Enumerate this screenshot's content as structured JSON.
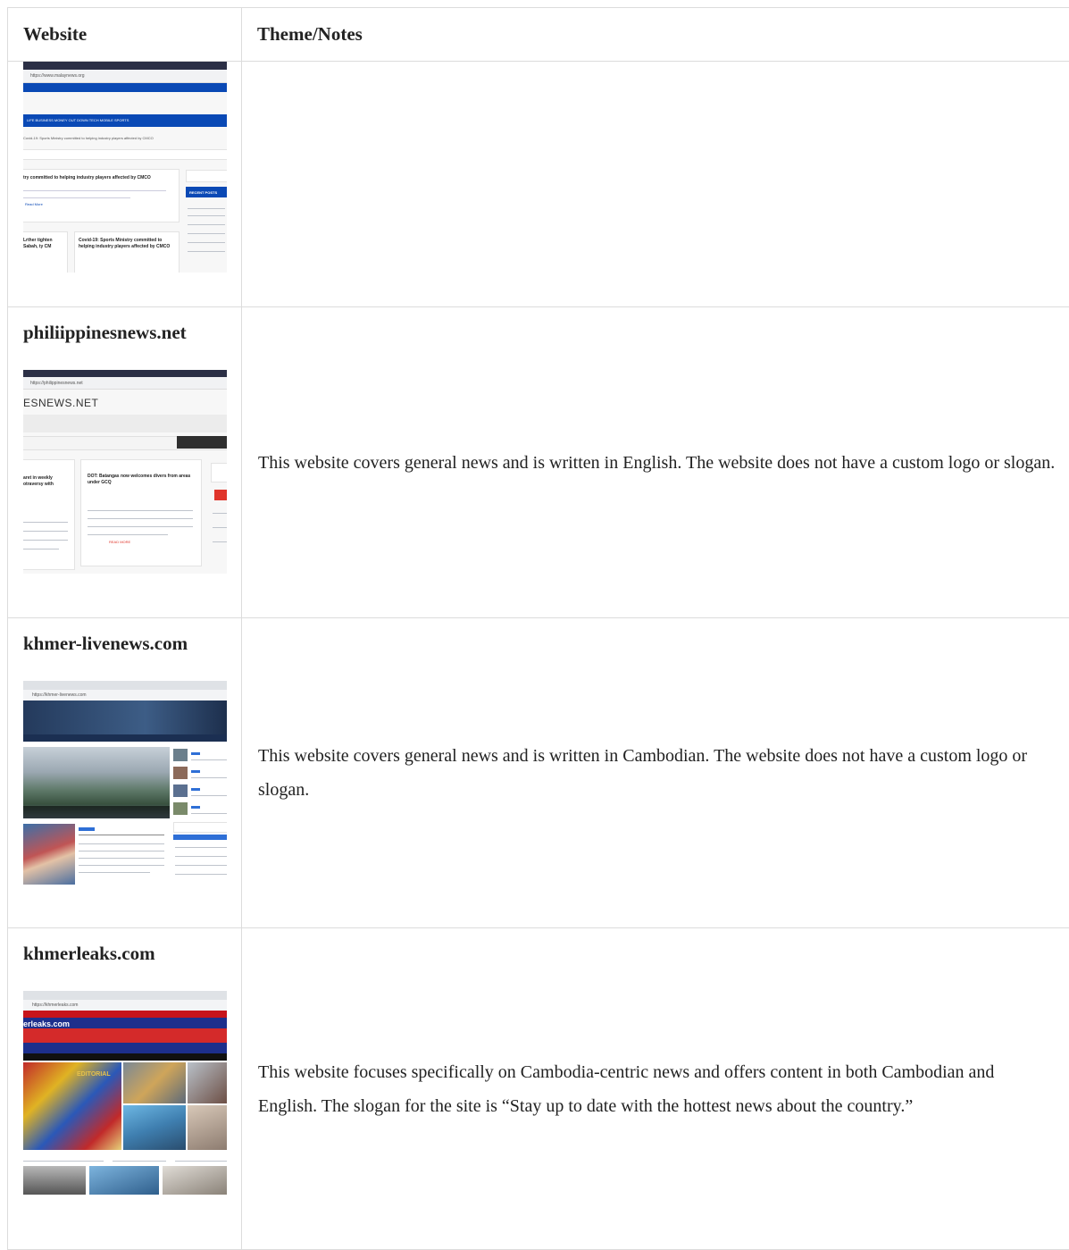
{
  "table": {
    "headers": {
      "website": "Website",
      "notes": "Theme/Notes"
    },
    "rows": [
      {
        "site": "",
        "notes": "",
        "thumb": {
          "url": "https://www.malaynews.org",
          "menu": "LIFE   BUSINESS   MONEY   OUT DOWN   TECH   MOBILE   SPORTS",
          "ticker": "Covid-19: Sports Ministry committed to helping industry players affected by CMCO",
          "headline": "try committed to helping industry players affected by CMCO",
          "side_title": "RECENT POSTS",
          "card_a": "Lrther tighten Sabah, ty CM",
          "card_b": "Covid-19: Sports Ministry committed to helping industry players affected by CMCO",
          "read_more": "Read More"
        }
      },
      {
        "site": "philiippinesnews.net",
        "notes": "This website covers general news and is written in English. The website does not have a custom logo or slogan.",
        "thumb": {
          "url": "https://philippinesnews.net",
          "masthead": "ESNEWS.NET",
          "card_title": "DOT: Batangas now welcomes divers from areas under GCQ",
          "left_title": "aret in weekly otraversy with",
          "read_more": "READ MORE"
        }
      },
      {
        "site": "khmer-livenews.com",
        "notes": "This website covers general news and is written in Cambodian. The website does not have a custom logo or slogan.",
        "thumb": {
          "url": "https://khmer-livenews.com"
        }
      },
      {
        "site": "khmerleaks.com",
        "notes": "This website focuses specifically on Cambodia-centric news and offers content in both Cambodian and English. The slogan for the site is “Stay up to date with the hottest news about the country.”",
        "thumb": {
          "url": "https://khmerleaks.com",
          "masthead": "erleaks.com",
          "banner": "EDITORIAL"
        }
      }
    ]
  }
}
